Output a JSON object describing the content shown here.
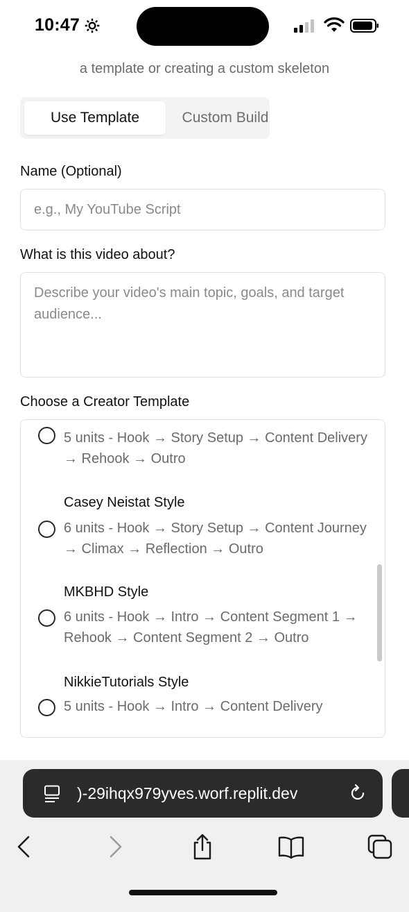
{
  "status_bar": {
    "time": "10:47",
    "icons": [
      "gear-icon",
      "signal-icon",
      "wifi-icon",
      "battery-icon"
    ]
  },
  "form": {
    "subtitle": "a template or creating a custom skeleton",
    "tabs": [
      {
        "label": "Use Template",
        "active": true
      },
      {
        "label": "Custom Build",
        "active": false
      }
    ],
    "name_label": "Name (Optional)",
    "name_placeholder": "e.g., My YouTube Script",
    "name_value": "",
    "about_label": "What is this video about?",
    "about_placeholder": "Describe your video's main topic, goals, and target audience...",
    "about_value": "",
    "template_label": "Choose a Creator Template",
    "templates": [
      {
        "name": "",
        "description": "5 units - Hook → Story Setup → Content Delivery → Rehook → Outro",
        "selected": false
      },
      {
        "name": "Casey Neistat Style",
        "description": "6 units - Hook → Story Setup → Content Journey → Climax → Reflection → Outro",
        "selected": false
      },
      {
        "name": "MKBHD Style",
        "description": "6 units - Hook → Intro → Content Segment 1 → Rehook → Content Segment 2 → Outro",
        "selected": false
      },
      {
        "name": "NikkieTutorials Style",
        "description": "5 units - Hook → Intro → Content Delivery",
        "selected": false
      }
    ]
  },
  "browser": {
    "url": ")-29ihqx979yves.worf.replit.dev",
    "toolbar_icons": [
      "back-icon",
      "forward-icon",
      "share-icon",
      "bookmarks-icon",
      "tabs-icon"
    ]
  },
  "colors": {
    "text_primary": "#111111",
    "text_muted": "#6b6b6b",
    "border": "#e0e0e0",
    "url_bar": "#2b2b2b"
  }
}
